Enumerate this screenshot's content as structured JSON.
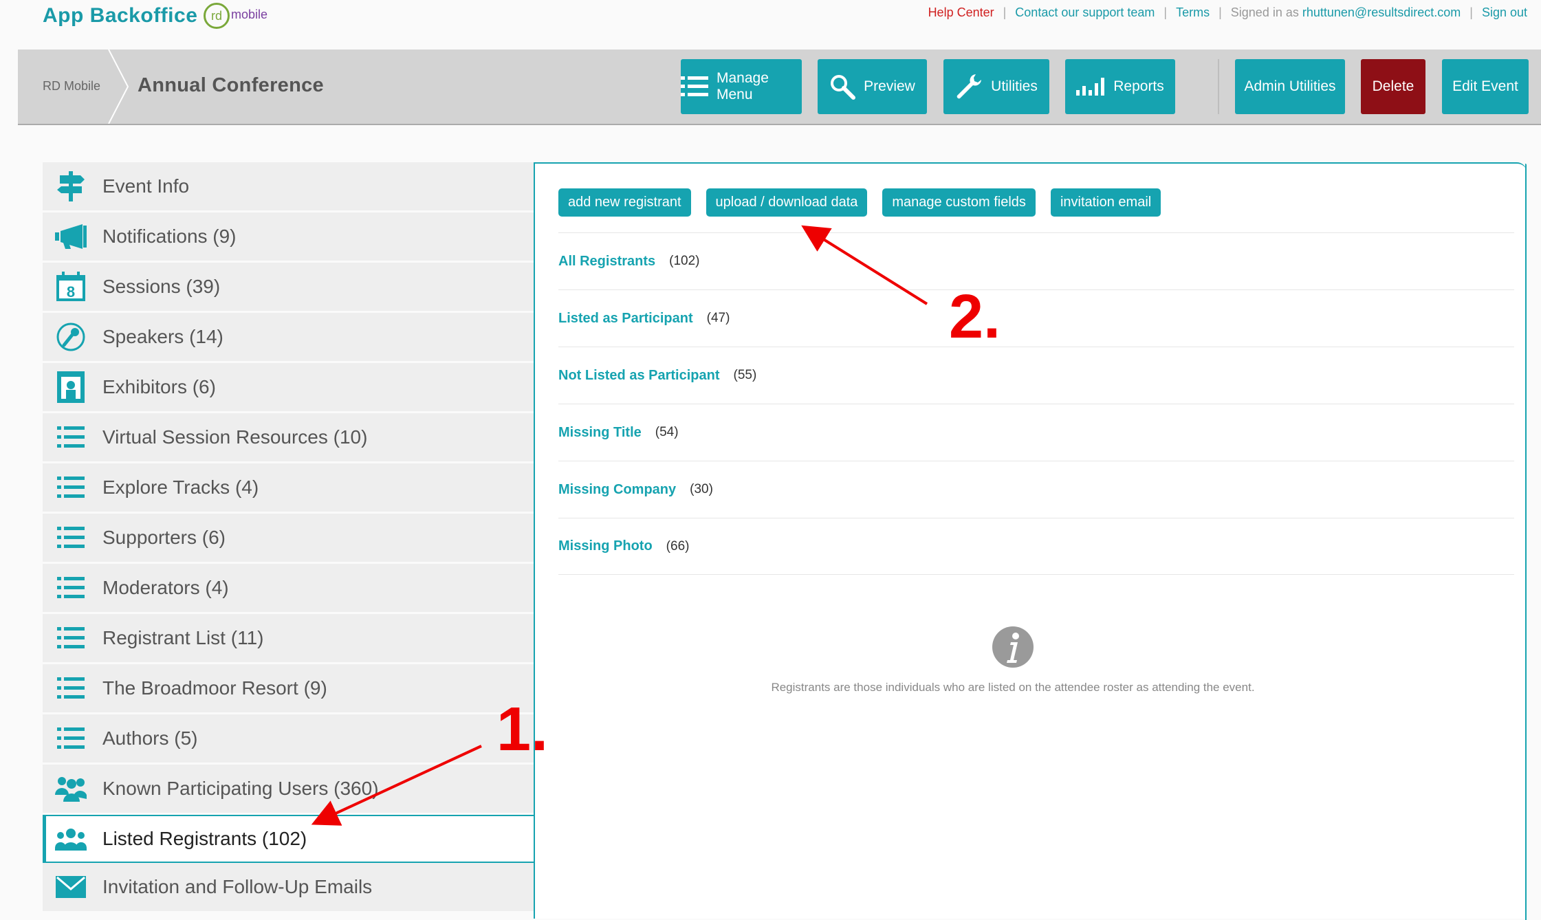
{
  "header": {
    "brand": "App Backoffice",
    "logo_mark": "rd",
    "logo_word": "mobile",
    "links": {
      "help": "Help Center",
      "support": "Contact our support team",
      "terms": "Terms",
      "signed_prefix": "Signed in as",
      "email": "rhuttunen@resultsdirect.com",
      "signout": "Sign out",
      "separator": "|"
    }
  },
  "eventbar": {
    "breadcrumb_root": "RD Mobile",
    "event_title": "Annual Conference",
    "buttons": [
      {
        "label": "Manage Menu",
        "icon": "list-icon"
      },
      {
        "label": "Preview",
        "icon": "search-icon"
      },
      {
        "label": "Utilities",
        "icon": "wrench-icon"
      },
      {
        "label": "Reports",
        "icon": "bar-chart-icon"
      },
      {
        "label": "Admin Utilities"
      },
      {
        "label": "Delete"
      },
      {
        "label": "Edit Event"
      }
    ]
  },
  "sidebar": {
    "items": [
      {
        "label": "Event Info",
        "icon": "signpost-icon"
      },
      {
        "label": "Notifications (9)",
        "icon": "megaphone-icon"
      },
      {
        "label": "Sessions (39)",
        "icon": "calendar-icon"
      },
      {
        "label": "Speakers (14)",
        "icon": "microphone-icon"
      },
      {
        "label": "Exhibitors (6)",
        "icon": "booth-icon"
      },
      {
        "label": "Virtual Session Resources (10)",
        "icon": "list-icon"
      },
      {
        "label": "Explore Tracks (4)",
        "icon": "list-icon"
      },
      {
        "label": "Supporters (6)",
        "icon": "list-icon"
      },
      {
        "label": "Moderators (4)",
        "icon": "list-icon"
      },
      {
        "label": "Registrant List (11)",
        "icon": "list-icon"
      },
      {
        "label": "The Broadmoor Resort (9)",
        "icon": "list-icon"
      },
      {
        "label": "Authors (5)",
        "icon": "list-icon"
      },
      {
        "label": "Known Participating Users (360)",
        "icon": "users-icon"
      },
      {
        "label": "Listed Registrants (102)",
        "icon": "group-icon",
        "active": true
      },
      {
        "label": "Invitation and Follow-Up Emails",
        "icon": "envelope-icon"
      }
    ]
  },
  "main": {
    "actions": [
      "add new registrant",
      "upload / download data",
      "manage custom fields",
      "invitation email"
    ],
    "filters": [
      {
        "label": "All Registrants",
        "count": "(102)"
      },
      {
        "label": "Listed as Participant",
        "count": "(47)"
      },
      {
        "label": "Not Listed as Participant",
        "count": "(55)"
      },
      {
        "label": "Missing Title",
        "count": "(54)"
      },
      {
        "label": "Missing Company",
        "count": "(30)"
      },
      {
        "label": "Missing Photo",
        "count": "(66)"
      }
    ],
    "info_text": "Registrants are those individuals who are listed on the attendee roster as attending the event."
  },
  "annotations": {
    "step1": "1.",
    "step2": "2.",
    "color": "#ee0000"
  },
  "colors": {
    "accent": "#16a3b0",
    "danger": "#8e0f16",
    "bar": "#d3d3d3"
  }
}
